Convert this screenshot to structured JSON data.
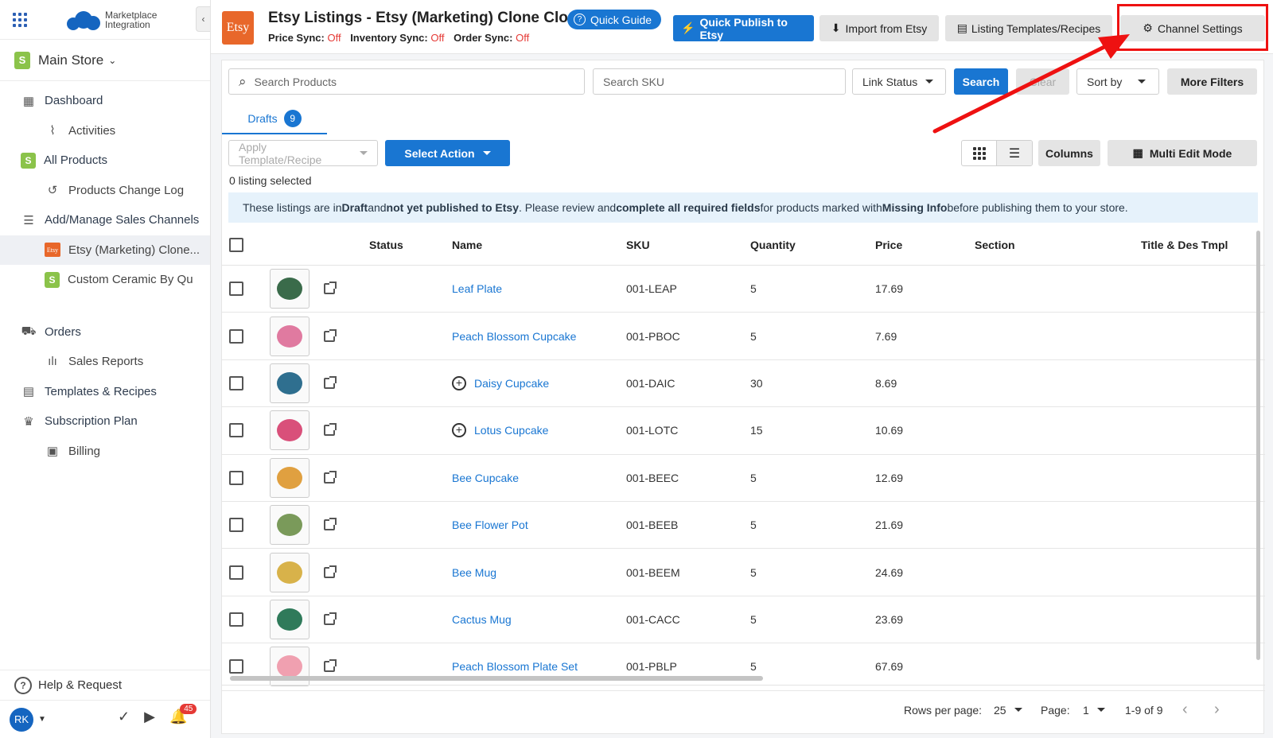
{
  "sidebar": {
    "logo_line1": "Marketplace",
    "logo_line2": "Integration",
    "store_name": "Main Store",
    "items": [
      {
        "label": "Dashboard",
        "icon": "dashboard-icon"
      },
      {
        "label": "Activities",
        "icon": "pulse-icon"
      },
      {
        "label": "All Products",
        "icon": "shop-icon"
      },
      {
        "label": "Products Change Log",
        "icon": "history-icon"
      },
      {
        "label": "Add/Manage Sales Channels",
        "icon": "list-icon"
      },
      {
        "label": "Etsy (Marketing) Clone...",
        "icon": "etsy-icon"
      },
      {
        "label": "Custom Ceramic By Qu",
        "icon": "shop-icon"
      },
      {
        "label": "Orders",
        "icon": "cart-icon"
      },
      {
        "label": "Sales Reports",
        "icon": "bar-chart-icon"
      },
      {
        "label": "Templates & Recipes",
        "icon": "document-icon"
      },
      {
        "label": "Subscription Plan",
        "icon": "crown-icon"
      },
      {
        "label": "Billing",
        "icon": "wallet-icon"
      }
    ],
    "etsy_mini": "Etsy",
    "help": "Help & Request",
    "avatar": "RK",
    "notifications": "45"
  },
  "header": {
    "logo": "Etsy",
    "title": "Etsy Listings - Etsy (Marketing) Clone Clone",
    "quick_guide": "Quick Guide",
    "price_sync_label": "Price Sync:",
    "price_sync": "Off",
    "inventory_sync_label": "Inventory Sync:",
    "inventory_sync": "Off",
    "order_sync_label": "Order Sync:",
    "order_sync": "Off",
    "quick_publish": "Quick Publish to Etsy",
    "import": "Import from Etsy",
    "templates": "Listing Templates/Recipes",
    "channel_settings": "Channel Settings"
  },
  "filters": {
    "search_products": "Search Products",
    "search_sku": "Search SKU",
    "link_status": "Link Status",
    "search": "Search",
    "clear": "Clear",
    "sort_by": "Sort by",
    "more_filters": "More Filters"
  },
  "tabs": {
    "drafts": "Drafts",
    "drafts_count": "9"
  },
  "toolbar": {
    "apply_template": "Apply Template/Recipe",
    "select_action": "Select Action",
    "columns": "Columns",
    "multi_edit": "Multi Edit Mode"
  },
  "selected_count": "0 listing selected",
  "info": {
    "p1": "These listings are in ",
    "b1": "Draft",
    "p2": " and ",
    "b2": "not yet published to Etsy",
    "p3": ". Please review and ",
    "b3": "complete all required fields",
    "p4": " for products marked with ",
    "b4": "Missing Info",
    "p5": " before publishing them to your store."
  },
  "table": {
    "headers": {
      "status": "Status",
      "name": "Name",
      "sku": "SKU",
      "quantity": "Quantity",
      "price": "Price",
      "section": "Section",
      "title_tmpl": "Title & Des Tmpl"
    },
    "rows": [
      {
        "name": "Leaf Plate",
        "sku": "001-LEAP",
        "qty": "5",
        "price": "17.69",
        "variants": false,
        "thumb": "#3a6b4a"
      },
      {
        "name": "Peach Blossom Cupcake",
        "sku": "001-PBOC",
        "qty": "5",
        "price": "7.69",
        "variants": false,
        "thumb": "#e07aa0"
      },
      {
        "name": "Daisy Cupcake",
        "sku": "001-DAIC",
        "qty": "30",
        "price": "8.69",
        "variants": true,
        "thumb": "#2f6f8f"
      },
      {
        "name": "Lotus Cupcake",
        "sku": "001-LOTC",
        "qty": "15",
        "price": "10.69",
        "variants": true,
        "thumb": "#d9507a"
      },
      {
        "name": "Bee Cupcake",
        "sku": "001-BEEC",
        "qty": "5",
        "price": "12.69",
        "variants": false,
        "thumb": "#e0a040"
      },
      {
        "name": "Bee Flower Pot",
        "sku": "001-BEEB",
        "qty": "5",
        "price": "21.69",
        "variants": false,
        "thumb": "#7a9a5a"
      },
      {
        "name": "Bee Mug",
        "sku": "001-BEEM",
        "qty": "5",
        "price": "24.69",
        "variants": false,
        "thumb": "#d8b24a"
      },
      {
        "name": "Cactus Mug",
        "sku": "001-CACC",
        "qty": "5",
        "price": "23.69",
        "variants": false,
        "thumb": "#2f7a5a"
      },
      {
        "name": "Peach Blossom Plate Set",
        "sku": "001-PBLP",
        "qty": "5",
        "price": "67.69",
        "variants": false,
        "thumb": "#f0a0b0"
      }
    ]
  },
  "pager": {
    "rows_label": "Rows per page:",
    "rows_value": "25",
    "page_label": "Page:",
    "page_value": "1",
    "range": "1-9 of 9"
  },
  "colors": {
    "accent": "#1976d2",
    "etsy": "#e8672a",
    "off": "#e53935",
    "highlight": "#ee1111"
  }
}
